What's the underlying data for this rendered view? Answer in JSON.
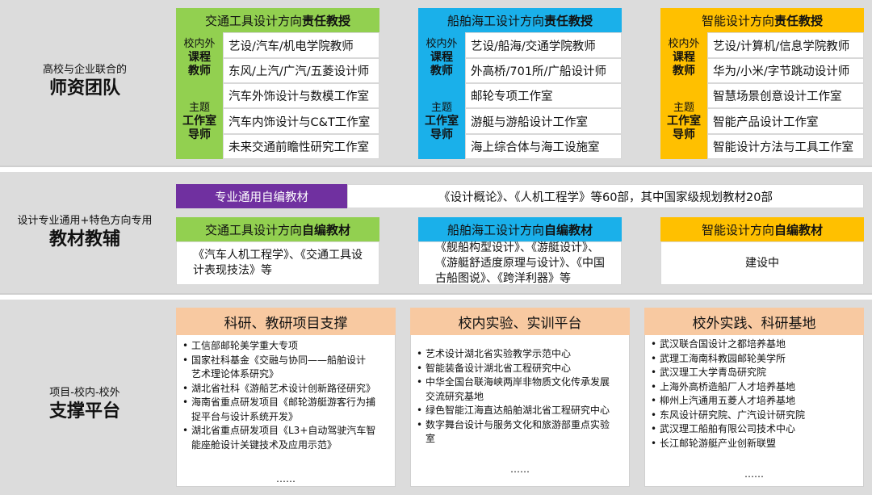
{
  "colors": {
    "transport": "#92d050",
    "marine": "#1ab0ea",
    "smart": "#ffc000",
    "purple": "#7030a0",
    "support_header": "#f8c9a1",
    "band": "#dcdcdc"
  },
  "faculty": {
    "subtitle": "高校与企业联合的",
    "title": "师资团队",
    "columns": [
      {
        "header_prefix": "交通工具设计方向",
        "header_bold": "责任教授",
        "cat1_top": "校内外",
        "cat1_bold": "课程\n教师",
        "cat2_top": "主题",
        "cat2_bold": "工作室\n导师",
        "items": [
          "艺设/汽车/机电学院教师",
          "东风/上汽/广汽/五菱设计师",
          "汽车外饰设计与数模工作室",
          "汽车内饰设计与C&T工作室",
          "未来交通前瞻性研究工作室"
        ]
      },
      {
        "header_prefix": "船舶海工设计方向",
        "header_bold": "责任教授",
        "cat1_top": "校内外",
        "cat1_bold": "课程\n教师",
        "cat2_top": "主题",
        "cat2_bold": "工作室\n导师",
        "items": [
          "艺设/船海/交通学院教师",
          "外高桥/701所/广船设计师",
          "邮轮专项工作室",
          "游艇与游船设计工作室",
          "海上综合体与海工设施室"
        ]
      },
      {
        "header_prefix": "智能设计方向",
        "header_bold": "责任教授",
        "cat1_top": "校内外",
        "cat1_bold": "课程\n教师",
        "cat2_top": "主题",
        "cat2_bold": "工作室\n导师",
        "items": [
          "艺设/计算机/信息学院教师",
          "华为/小米/字节跳动设计师",
          "智慧场景创意设计工作室",
          "智能产品设计工作室",
          "智能设计方法与工具工作室"
        ]
      }
    ]
  },
  "textbooks": {
    "subtitle": "设计专业通用+特色方向专用",
    "title": "教材教辅",
    "general_label": "专业通用自编教材",
    "general_text": "《设计概论》、《人机工程学》等60部，其中国家级规划教材20部",
    "columns": [
      {
        "header_prefix": "交通工具设计方向",
        "header_bold": "自编教材",
        "text": "《汽车人机工程学》、《交通工具设\n计表现技法》等"
      },
      {
        "header_prefix": "船舶海工设计方向",
        "header_bold": "自编教材",
        "text": "《舰船构型设计》、《游艇设计》、\n《游艇舒适度原理与设计》、《中国\n古船图说》、《跨洋利器》等"
      },
      {
        "header_prefix": "智能设计方向",
        "header_bold": "自编教材",
        "text": "建设中"
      }
    ]
  },
  "platform": {
    "subtitle": "项目-校内-校外",
    "title": "支撑平台",
    "panels": [
      {
        "title": "科研、教研项目支撑",
        "items": [
          "工信部邮轮美学重大专项",
          "国家社科基金《交融与协同——船舶设计\n艺术理论体系研究》",
          "湖北省社科《游船艺术设计创新路径研究》",
          "海南省重点研发项目《邮轮游艇游客行为捕\n捉平台与设计系统开发》",
          "湖北省重点研发项目《L3+自动驾驶汽车智\n能座舱设计关键技术及应用示范》"
        ],
        "ellipsis": "……"
      },
      {
        "title": "校内实验、实训平台",
        "items": [
          "艺术设计湖北省实验教学示范中心",
          "智能装备设计湖北省工程研究中心",
          "中华全国台联海峡两岸非物质文化传承发展\n交流研究基地",
          "绿色智能江海直达船舶湖北省工程研究中心",
          "数字舞台设计与服务文化和旅游部重点实验\n室"
        ],
        "ellipsis": "……"
      },
      {
        "title": "校外实践、科研基地",
        "items": [
          "武汉联合国设计之都培养基地",
          "武理工海南科教园邮轮美学所",
          "武汉理工大学青岛研究院",
          "上海外高桥造船厂人才培养基地",
          "柳州上汽通用五菱人才培养基地",
          "东风设计研究院、广汽设计研究院",
          "武汉理工船舶有限公司技术中心",
          "长江邮轮游艇产业创新联盟"
        ],
        "ellipsis": "……"
      }
    ]
  }
}
